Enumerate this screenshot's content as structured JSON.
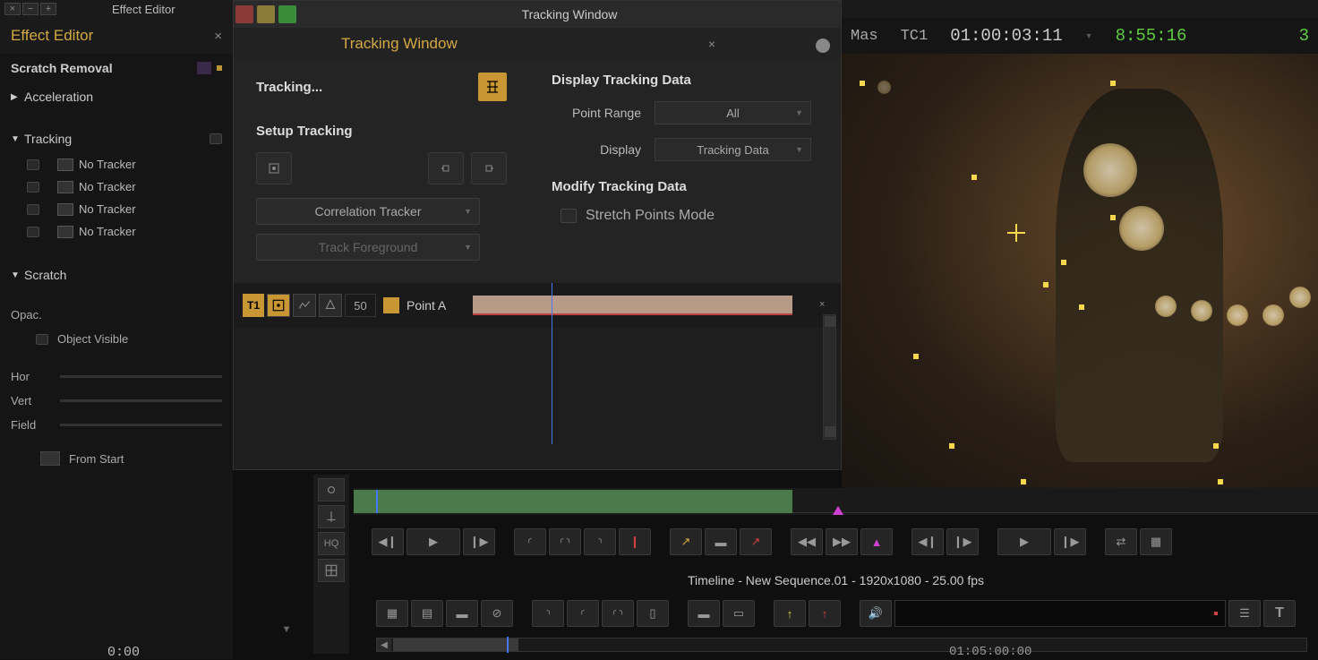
{
  "topbar": {
    "title": "Effect Editor"
  },
  "effect_panel": {
    "header": "Effect Editor",
    "section1": "Scratch Removal",
    "group_acceleration": "Acceleration",
    "group_tracking": "Tracking",
    "trackers": [
      "No Tracker",
      "No Tracker",
      "No Tracker",
      "No Tracker"
    ],
    "group_scratch": "Scratch",
    "opac": "Opac.",
    "object_visible": "Object Visible",
    "hor": "Hor",
    "vert": "Vert",
    "field": "Field",
    "from_start": "From Start",
    "time": "0:00"
  },
  "tracking_window": {
    "titlebar": "Tracking Window",
    "header": "Tracking Window",
    "tracking_label": "Tracking...",
    "setup_tracking": "Setup Tracking",
    "dd_correlation": "Correlation Tracker",
    "dd_foreground": "Track Foreground",
    "display_section": "Display Tracking Data",
    "point_range_label": "Point Range",
    "point_range_val": "All",
    "display_label": "Display",
    "display_val": "Tracking Data",
    "modify_section": "Modify Tracking Data",
    "stretch_mode": "Stretch Points Mode",
    "t1": "T1",
    "track_num": "50",
    "point_a": "Point A"
  },
  "timecode": {
    "mas": "Mas",
    "tc1": "TC1",
    "main_tc": "01:00:03:11",
    "clock": "8:55:16",
    "partial": "3"
  },
  "link_col": {
    "hq": "HQ"
  },
  "timeline": {
    "caption": "Timeline - New Sequence.01 - 1920x1080 - 25.00 fps",
    "tc_right": "01:05:00:00"
  }
}
